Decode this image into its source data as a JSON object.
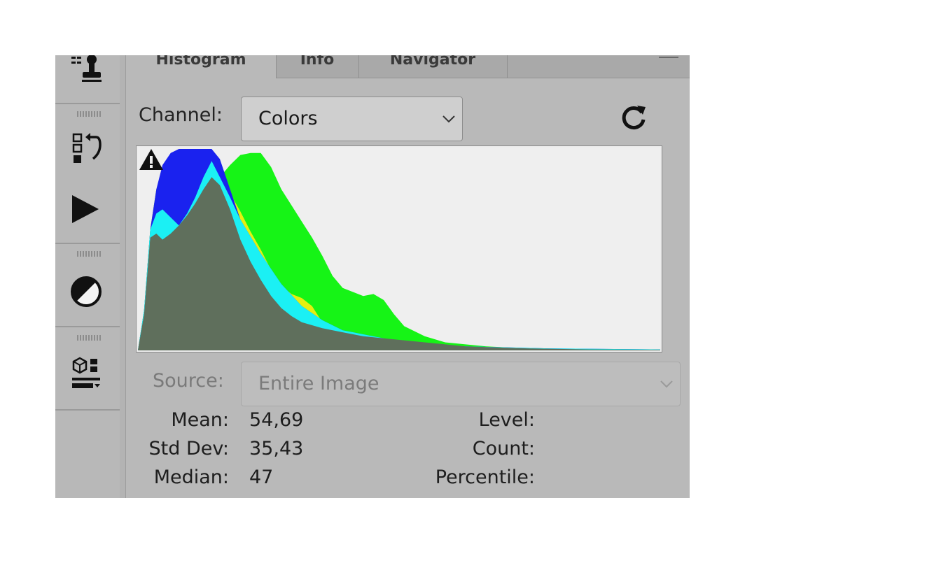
{
  "toolstrip": {
    "tools": [
      {
        "icon": "clone-source-icon"
      },
      {
        "icon": "history-icon"
      },
      {
        "icon": "play-actions-icon"
      },
      {
        "icon": "adjustments-icon"
      },
      {
        "icon": "3d-materials-icon"
      }
    ]
  },
  "panel": {
    "tabs": [
      {
        "label": "Histogram",
        "active": true
      },
      {
        "label": "Info",
        "active": false
      },
      {
        "label": "Navigator",
        "active": false
      }
    ],
    "channel_label": "Channel:",
    "channel_value": "Colors",
    "source_label": "Source:",
    "source_value": "Entire Image",
    "stats": {
      "mean_label": "Mean:",
      "mean_value": "54,69",
      "std_label": "Std Dev:",
      "std_value": "35,43",
      "median_label": "Median:",
      "median_value": "47",
      "level_label": "Level:",
      "count_label": "Count:",
      "percentile_label": "Percentile:"
    }
  },
  "chart_data": {
    "type": "area",
    "title": "",
    "xlabel": "",
    "ylabel": "",
    "xlim": [
      0,
      255
    ],
    "ylim": [
      0,
      100
    ],
    "grid": false,
    "colors": {
      "green": "#16f416",
      "yellow": "#e6ef10",
      "blue": "#1a22ef",
      "cyan": "#1bf0f4",
      "magenta": "#ee16ee",
      "red": "#f01010",
      "gray": "#5f6f5c"
    },
    "series": [
      {
        "color": "green",
        "x": [
          0,
          3,
          6,
          9,
          12,
          16,
          20,
          24,
          28,
          32,
          36,
          40,
          45,
          50,
          55,
          60,
          65,
          70,
          75,
          80,
          85,
          90,
          95,
          100,
          105,
          110,
          115,
          120,
          125,
          130,
          140,
          150,
          170,
          190,
          210,
          230,
          255
        ],
        "y": [
          0,
          20,
          60,
          80,
          86,
          88,
          92,
          95,
          96,
          96,
          92,
          86,
          92,
          97,
          98,
          98,
          91,
          80,
          72,
          64,
          56,
          47,
          37,
          31,
          29,
          27,
          28,
          25,
          18,
          12,
          7,
          4,
          2,
          1,
          0.5,
          0.5,
          0.5
        ]
      },
      {
        "color": "yellow",
        "x": [
          0,
          3,
          6,
          9,
          12,
          16,
          20,
          24,
          28,
          32,
          36,
          40,
          45,
          50,
          55,
          60,
          65,
          70,
          75,
          80,
          85,
          90,
          95,
          100,
          110,
          120,
          130,
          140,
          160,
          190,
          255
        ],
        "y": [
          0,
          20,
          60,
          80,
          86,
          88,
          92,
          95,
          96,
          96,
          92,
          86,
          78,
          69,
          59,
          50,
          40,
          32,
          28,
          26,
          22,
          14,
          10,
          8,
          6,
          4,
          3,
          2,
          1,
          0.5,
          0.2
        ]
      },
      {
        "color": "blue",
        "x": [
          0,
          3,
          6,
          9,
          12,
          16,
          20,
          24,
          28,
          32,
          36,
          40,
          45,
          50,
          60,
          70,
          80,
          90,
          100,
          120,
          140,
          160,
          200,
          255
        ],
        "y": [
          0,
          20,
          60,
          80,
          92,
          98,
          100,
          100,
          100,
          100,
          100,
          95,
          80,
          65,
          48,
          33,
          22,
          15,
          10,
          6,
          3,
          2,
          1,
          0.5
        ]
      },
      {
        "color": "cyan",
        "x": [
          0,
          3,
          6,
          9,
          12,
          16,
          20,
          24,
          28,
          32,
          36,
          40,
          45,
          50,
          60,
          70,
          80,
          90,
          100,
          120,
          140,
          160,
          200,
          255
        ],
        "y": [
          0,
          20,
          60,
          68,
          70,
          66,
          62,
          68,
          76,
          86,
          94,
          86,
          76,
          65,
          48,
          33,
          22,
          15,
          10,
          6,
          3,
          2,
          1,
          0.5
        ]
      },
      {
        "color": "gray",
        "x": [
          0,
          3,
          6,
          9,
          12,
          16,
          20,
          24,
          28,
          32,
          36,
          40,
          45,
          50,
          55,
          60,
          65,
          70,
          75,
          80,
          90,
          100,
          110,
          120,
          140,
          160,
          190,
          220,
          255
        ],
        "y": [
          0,
          18,
          56,
          58,
          55,
          58,
          62,
          67,
          73,
          80,
          86,
          82,
          70,
          55,
          44,
          35,
          27,
          21,
          17,
          14,
          11,
          9,
          7,
          6,
          4,
          2,
          1,
          0.5,
          0.3
        ]
      }
    ]
  }
}
